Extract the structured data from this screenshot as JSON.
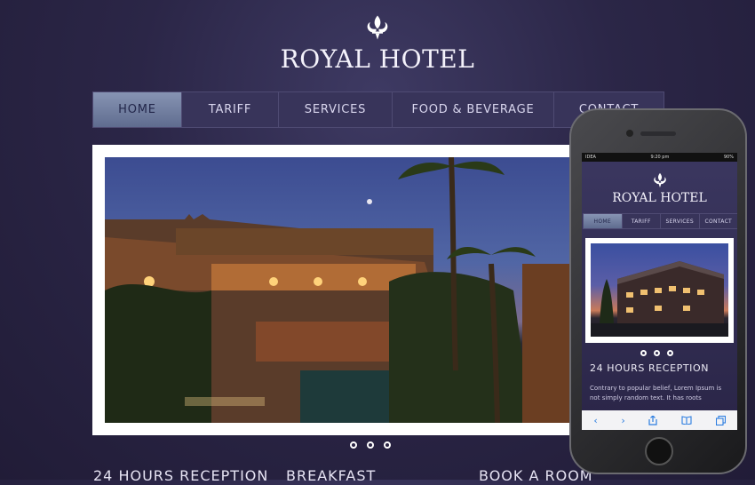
{
  "brand": {
    "title": "ROYAL HOTEL",
    "logo_icon": "fleur-de-lis-icon"
  },
  "nav": {
    "items": [
      {
        "label": "HOME",
        "active": true
      },
      {
        "label": "TARIFF",
        "active": false
      },
      {
        "label": "SERVICES",
        "active": false
      },
      {
        "label": "FOOD & BEVERAGE",
        "active": false
      },
      {
        "label": "CONTACT",
        "active": false
      }
    ]
  },
  "slider": {
    "dots": 3
  },
  "sections": {
    "headings": [
      "24 HOURS RECEPTION",
      "BREAKFAST",
      "BOOK A ROOM"
    ]
  },
  "mobile": {
    "status": {
      "carrier": "IDEA",
      "time": "9:20 pm",
      "battery": "90%"
    },
    "brand": "ROYAL HOTEL",
    "nav": [
      "HOME",
      "TARIFF",
      "SERVICES",
      "CONTACT"
    ],
    "heading": "24 HOURS RECEPTION",
    "text": "Contrary to popular belief, Lorem Ipsum is not simply random text. It has roots",
    "toolbar": {
      "back": "‹",
      "forward": "›"
    }
  },
  "colors": {
    "background": "#2b2647",
    "nav_active": "#7582a6",
    "accent": "#2b7de0"
  }
}
